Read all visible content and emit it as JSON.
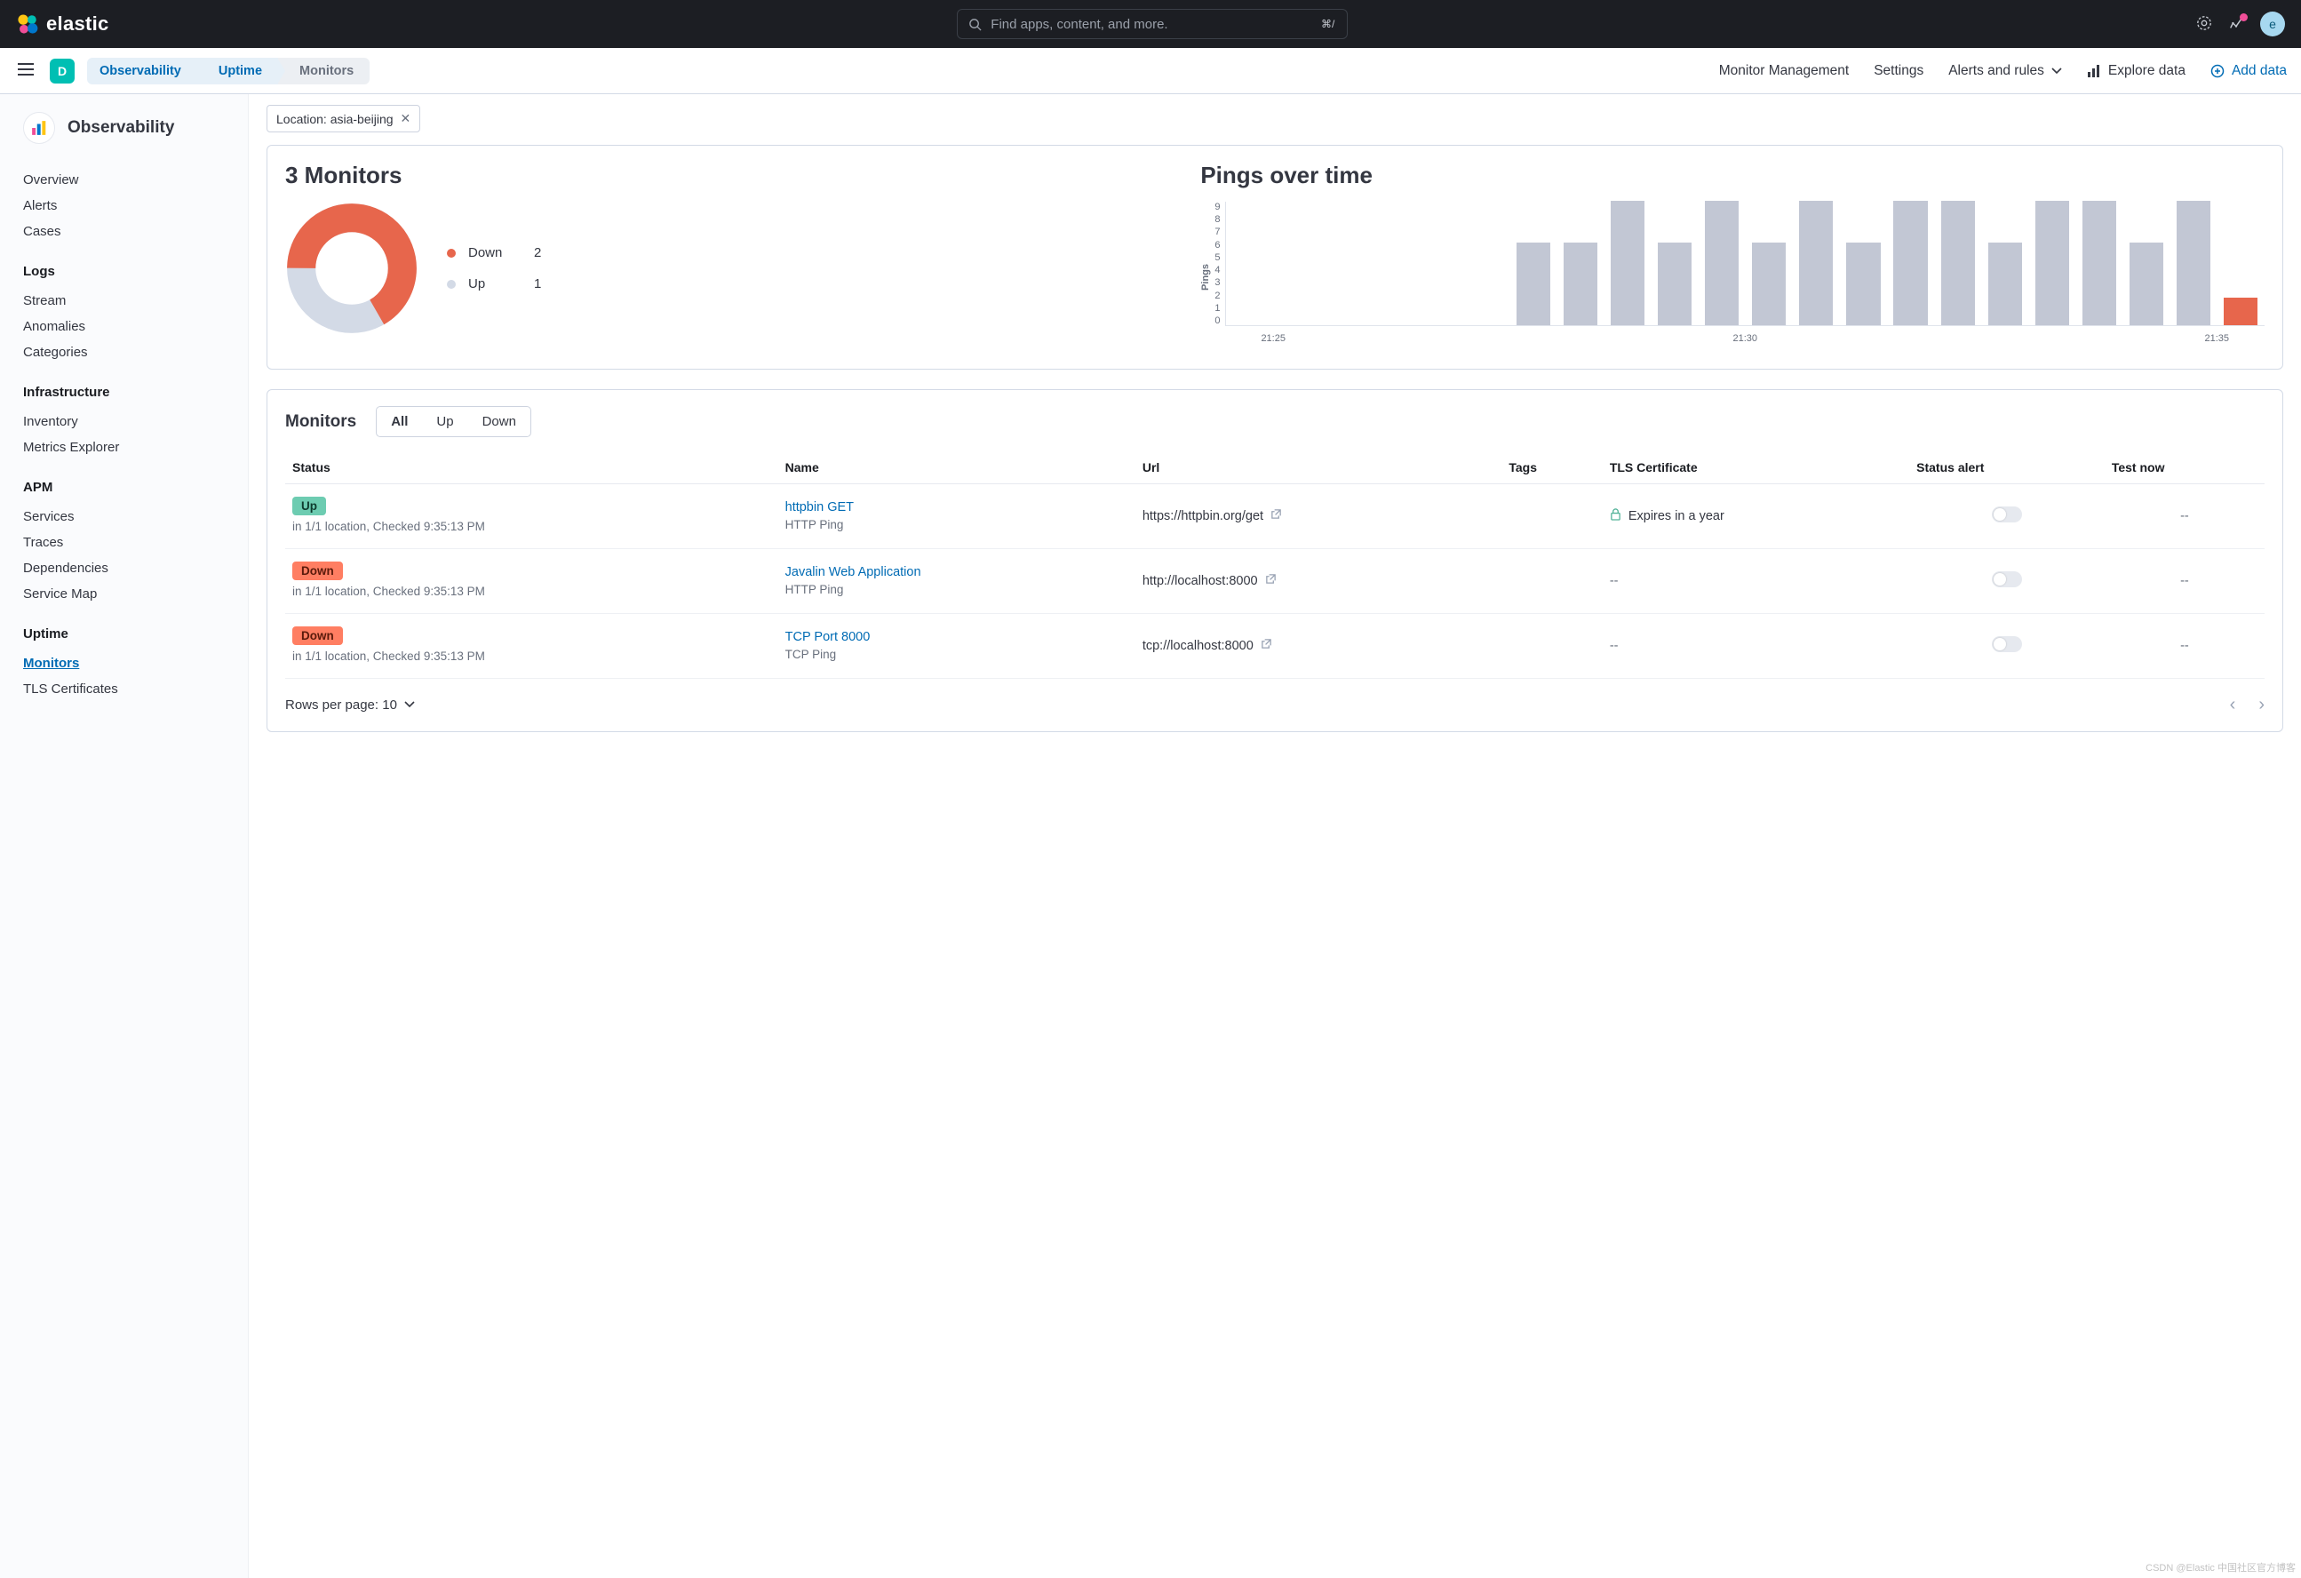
{
  "brand": "elastic",
  "search": {
    "placeholder": "Find apps, content, and more.",
    "shortcut": "⌘/"
  },
  "avatar_letter": "e",
  "space_letter": "D",
  "breadcrumbs": [
    {
      "label": "Observability",
      "link": true
    },
    {
      "label": "Uptime",
      "link": true
    },
    {
      "label": "Monitors",
      "link": false
    }
  ],
  "subnav": {
    "monitor_mgmt": "Monitor Management",
    "settings": "Settings",
    "alerts": "Alerts and rules",
    "explore": "Explore data",
    "add_data": "Add data"
  },
  "sidebar": {
    "title": "Observability",
    "groups": [
      {
        "title": "",
        "items": [
          "Overview",
          "Alerts",
          "Cases"
        ]
      },
      {
        "title": "Logs",
        "items": [
          "Stream",
          "Anomalies",
          "Categories"
        ]
      },
      {
        "title": "Infrastructure",
        "items": [
          "Inventory",
          "Metrics Explorer"
        ]
      },
      {
        "title": "APM",
        "items": [
          "Services",
          "Traces",
          "Dependencies",
          "Service Map"
        ]
      },
      {
        "title": "Uptime",
        "items": [
          "Monitors",
          "TLS Certificates"
        ],
        "active": "Monitors"
      }
    ]
  },
  "filter_chip": "Location: asia-beijing",
  "summary": {
    "title": "3 Monitors",
    "down": 2,
    "up": 1,
    "down_label": "Down",
    "up_label": "Up",
    "colors": {
      "down": "#e7664c",
      "up": "#d3dae6"
    }
  },
  "pings": {
    "title": "Pings over time",
    "ylabel": "Pings",
    "ymax": 9,
    "xticks": [
      "21:25",
      "21:30",
      "21:35"
    ]
  },
  "chart_data": [
    {
      "type": "pie",
      "title": "3 Monitors",
      "series": [
        {
          "name": "Down",
          "value": 2,
          "color": "#e7664c"
        },
        {
          "name": "Up",
          "value": 1,
          "color": "#d3dae6"
        }
      ]
    },
    {
      "type": "bar",
      "title": "Pings over time",
      "xlabel": "",
      "ylabel": "Pings",
      "ylim": [
        0,
        9
      ],
      "stacked": true,
      "x_tick_labels": [
        "21:25",
        "21:30",
        "21:35"
      ],
      "categories": [
        "b1",
        "b2",
        "b3",
        "b4",
        "b5",
        "b6",
        "b7",
        "b8",
        "b9",
        "b10",
        "b11",
        "b12",
        "b13",
        "b14",
        "b15",
        "b16",
        "b17",
        "b18",
        "b19",
        "b20",
        "b21",
        "b22"
      ],
      "series": [
        {
          "name": "Up",
          "color": "#c2c7d4",
          "values": [
            0,
            0,
            0,
            0,
            0,
            0,
            6,
            6,
            9,
            6,
            9,
            6,
            9,
            6,
            9,
            9,
            6,
            9,
            9,
            6,
            9,
            0
          ]
        },
        {
          "name": "Down",
          "color": "#e7664c",
          "values": [
            0,
            0,
            0,
            0,
            0,
            0,
            0,
            0,
            0,
            0,
            0,
            0,
            0,
            0,
            0,
            0,
            0,
            0,
            0,
            0,
            0,
            2
          ]
        }
      ]
    }
  ],
  "monitors_section": {
    "title": "Monitors",
    "tabs": [
      "All",
      "Up",
      "Down"
    ],
    "active_tab": "All",
    "columns": [
      "Status",
      "Name",
      "Url",
      "Tags",
      "TLS Certificate",
      "Status alert",
      "Test now"
    ],
    "rows": [
      {
        "status": "Up",
        "status_sub": "in 1/1 location, Checked 9:35:13 PM",
        "name": "httpbin GET",
        "type": "HTTP Ping",
        "url": "https://httpbin.org/get",
        "tags": "",
        "tls": "Expires in a year",
        "test_now": "--"
      },
      {
        "status": "Down",
        "status_sub": "in 1/1 location, Checked 9:35:13 PM",
        "name": "Javalin Web Application",
        "type": "HTTP Ping",
        "url": "http://localhost:8000",
        "tags": "",
        "tls": "--",
        "test_now": "--"
      },
      {
        "status": "Down",
        "status_sub": "in 1/1 location, Checked 9:35:13 PM",
        "name": "TCP Port 8000",
        "type": "TCP Ping",
        "url": "tcp://localhost:8000",
        "tags": "",
        "tls": "--",
        "test_now": "--"
      }
    ],
    "pager": {
      "rpp_label": "Rows per page: 10"
    }
  },
  "watermark": "CSDN @Elastic 中国社区官方博客"
}
